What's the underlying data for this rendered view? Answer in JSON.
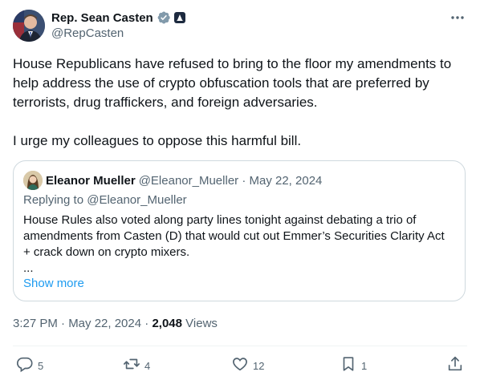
{
  "author": {
    "display_name": "Rep. Sean Casten",
    "handle": "@RepCasten"
  },
  "tweet": {
    "paragraphs": [
      "House Republicans have refused to bring to the floor my amendments to help address the use of crypto obfuscation tools that are preferred by terrorists, drug traffickers, and foreign adversaries.",
      "I urge my colleagues to oppose this harmful bill."
    ],
    "time": "3:27 PM · May 22, 2024",
    "separator": "·",
    "views_count": "2,048",
    "views_label": "Views"
  },
  "quote": {
    "display_name": "Eleanor Mueller",
    "meta": "@Eleanor_Mueller · May 22, 2024",
    "replying_to": "Replying to @Eleanor_Mueller",
    "text_lines": [
      "House Rules also voted along party lines tonight against debating a trio of amendments from Casten (D) that would cut out Emmer’s Securities Clarity Act + crack down on crypto mixers.",
      "..."
    ],
    "show_more": "Show more"
  },
  "actions": {
    "replies": "5",
    "reposts": "4",
    "likes": "12",
    "bookmarks": "1"
  },
  "colors": {
    "text_primary": "#0f1419",
    "text_secondary": "#536471",
    "link": "#1d9bf0",
    "border": "#cfd9de",
    "verified_badge": "#829aab"
  },
  "icons": [
    "verified-badge-icon",
    "government-badge-icon",
    "more-icon",
    "reply-icon",
    "repost-icon",
    "like-icon",
    "bookmark-icon",
    "share-icon"
  ]
}
